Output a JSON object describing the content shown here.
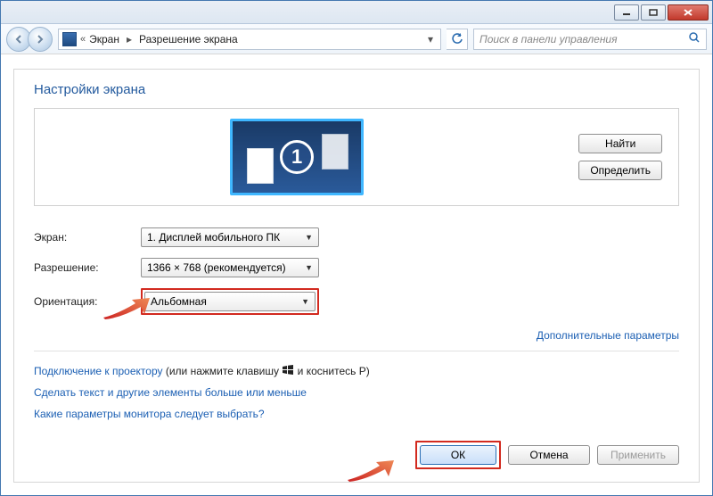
{
  "breadcrumb": {
    "root_glyph": "«",
    "item1": "Экран",
    "item2": "Разрешение экрана"
  },
  "search": {
    "placeholder": "Поиск в панели управления"
  },
  "title": "Настройки экрана",
  "monitor_number": "1",
  "preview_buttons": {
    "find": "Найти",
    "identify": "Определить"
  },
  "form": {
    "display_label": "Экран:",
    "display_value": "1. Дисплей мобильного ПК",
    "resolution_label": "Разрешение:",
    "resolution_value": "1366 × 768 (рекомендуется)",
    "orientation_label": "Ориентация:",
    "orientation_value": "Альбомная"
  },
  "advanced_link": "Дополнительные параметры",
  "links": {
    "projector_link": "Подключение к проектору",
    "projector_hint_pre": " (или нажмите клавишу ",
    "projector_hint_post": " и коснитесь P)",
    "text_size": "Сделать текст и другие элементы больше или меньше",
    "monitor_params": "Какие параметры монитора следует выбрать?"
  },
  "buttons": {
    "ok": "ОК",
    "cancel": "Отмена",
    "apply": "Применить"
  }
}
